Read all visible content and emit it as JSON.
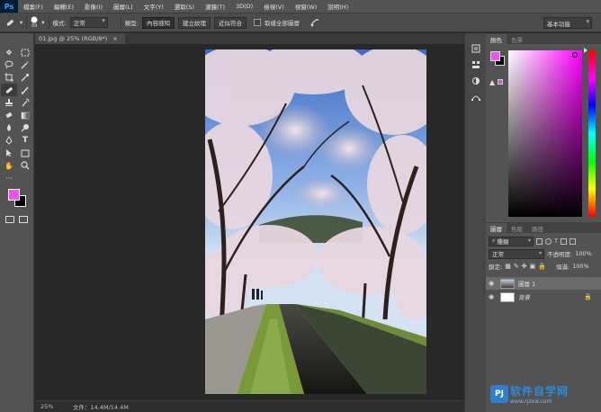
{
  "app": {
    "logo": "Ps"
  },
  "menubar": {
    "items": [
      "檔案(F)",
      "編輯(E)",
      "影像(I)",
      "圖層(L)",
      "文字(Y)",
      "選取(S)",
      "濾鏡(T)",
      "3D(D)",
      "檢視(V)",
      "視窗(W)",
      "說明(H)"
    ]
  },
  "options": {
    "tool_icon": "spot-healing-brush-icon",
    "brush_size": "89",
    "mode_label": "模式:",
    "mode_value": "正常",
    "type_label": "類型:",
    "type_buttons": [
      "內容感知",
      "建立紋理",
      "近似符合"
    ],
    "sample_all_label": "取樣全部圖層",
    "workspace": "基本功能"
  },
  "document": {
    "tab_title": "01.jpg @ 25% (RGB/8*)",
    "tab_close": "×",
    "zoom": "25%",
    "doc_size": "文件：14.4M/14.4M"
  },
  "color_panel": {
    "tabs": [
      "顏色",
      "色票"
    ],
    "foreground": "#e857e8",
    "background": "#000000"
  },
  "layers_panel": {
    "tabs": [
      "圖層",
      "色版",
      "路徑"
    ],
    "filter_kind": "種類",
    "blend_mode": "正常",
    "opacity_label": "不透明度:",
    "opacity_value": "100%",
    "lock_label": "鎖定:",
    "fill_label": "填滿:",
    "fill_value": "100%",
    "layers": [
      {
        "name": "圖層 1",
        "selected": true
      },
      {
        "name": "背景",
        "locked": true
      }
    ]
  },
  "watermark": {
    "logo": "PJ",
    "title": "软件自学网",
    "url": "www.rjzxw.com"
  }
}
